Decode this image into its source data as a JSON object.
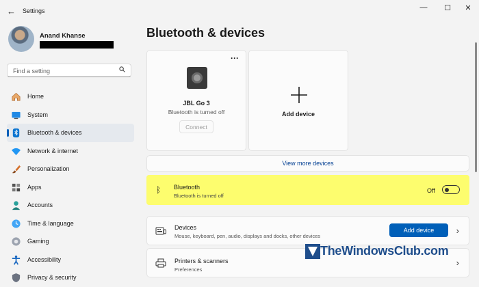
{
  "window": {
    "title": "Settings",
    "back_icon": "back-arrow-icon",
    "controls": {
      "minimize": "—",
      "maximize": "☐",
      "close": "✕"
    }
  },
  "profile": {
    "name": "Anand Khanse"
  },
  "search": {
    "placeholder": "Find a setting"
  },
  "sidebar": {
    "items": [
      {
        "label": "Home",
        "icon": "home-icon",
        "color": "#c07a3a"
      },
      {
        "label": "System",
        "icon": "system-icon",
        "color": "#0a74d0"
      },
      {
        "label": "Bluetooth & devices",
        "icon": "bluetooth-icon",
        "color": "#0a74d0",
        "selected": true
      },
      {
        "label": "Network & internet",
        "icon": "wifi-icon",
        "color": "#1e88e5"
      },
      {
        "label": "Personalization",
        "icon": "brush-icon",
        "color": "#d46f2a"
      },
      {
        "label": "Apps",
        "icon": "apps-icon",
        "color": "#4b5563"
      },
      {
        "label": "Accounts",
        "icon": "accounts-icon",
        "color": "#2aa19b"
      },
      {
        "label": "Time & language",
        "icon": "globe-clock-icon",
        "color": "#1e88e5"
      },
      {
        "label": "Gaming",
        "icon": "gamepad-icon",
        "color": "#6b7280"
      },
      {
        "label": "Accessibility",
        "icon": "accessibility-icon",
        "color": "#1565c0"
      },
      {
        "label": "Privacy & security",
        "icon": "shield-icon",
        "color": "#6b7280"
      }
    ]
  },
  "main": {
    "title": "Bluetooth & devices",
    "device_card": {
      "name": "JBL Go 3",
      "status": "Bluetooth is turned off",
      "connect_label": "Connect",
      "more": "···"
    },
    "add_card": {
      "label": "Add device"
    },
    "view_more": "View more devices",
    "bluetooth": {
      "title": "Bluetooth",
      "subtitle": "Bluetooth is turned off",
      "state_label": "Off",
      "highlight_color": "#fdfd6e"
    },
    "devices_row": {
      "title": "Devices",
      "subtitle": "Mouse, keyboard, pen, audio, displays and docks, other devices",
      "button": "Add device"
    },
    "printers_row": {
      "title": "Printers & scanners",
      "subtitle": "Preferences"
    }
  },
  "watermark": {
    "text": "TheWindowsClub.com"
  },
  "colors": {
    "accent": "#005fb8",
    "link": "#003e92"
  }
}
